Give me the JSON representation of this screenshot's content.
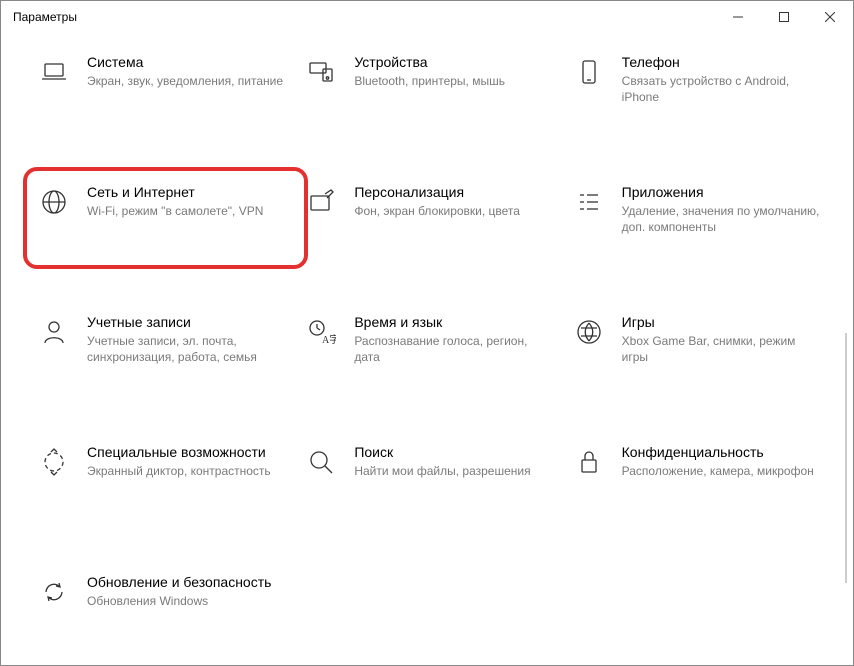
{
  "window": {
    "title": "Параметры"
  },
  "tiles": [
    {
      "title": "Система",
      "desc": "Экран, звук, уведомления, питание"
    },
    {
      "title": "Устройства",
      "desc": "Bluetooth, принтеры, мышь"
    },
    {
      "title": "Телефон",
      "desc": "Связать устройство с Android, iPhone"
    },
    {
      "title": "Сеть и Интернет",
      "desc": "Wi-Fi, режим \"в самолете\", VPN"
    },
    {
      "title": "Персонализация",
      "desc": "Фон, экран блокировки, цвета"
    },
    {
      "title": "Приложения",
      "desc": "Удаление, значения по умолчанию, доп. компоненты"
    },
    {
      "title": "Учетные записи",
      "desc": "Учетные записи, эл. почта, синхронизация, работа, семья"
    },
    {
      "title": "Время и язык",
      "desc": "Распознавание голоса, регион, дата"
    },
    {
      "title": "Игры",
      "desc": "Xbox Game Bar, снимки, режим игры"
    },
    {
      "title": "Специальные возможности",
      "desc": "Экранный диктор, контрастность"
    },
    {
      "title": "Поиск",
      "desc": "Найти мои файлы, разрешения"
    },
    {
      "title": "Конфиденциальность",
      "desc": "Расположение, камера, микрофон"
    },
    {
      "title": "Обновление и безопасность",
      "desc": "Обновления Windows"
    }
  ]
}
